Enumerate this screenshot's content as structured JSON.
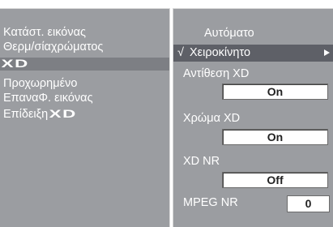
{
  "left_menu": {
    "items": [
      {
        "label": "Κατάστ. εικόνας"
      },
      {
        "label": "Θερμ/σίαχρώματος"
      },
      {
        "label": "XD"
      },
      {
        "label": "Προχωρημένο"
      },
      {
        "label": "ΕπαναΦ. εικόνας"
      },
      {
        "label": "Επίδειξη",
        "logo": "XD"
      }
    ]
  },
  "right_menu": {
    "auto_label": "Αυτόματο",
    "manual_label": "Χειροκίνητο",
    "check_mark": "√",
    "contrast_xd": {
      "label": "Αντίθεση XD",
      "value": "On"
    },
    "color_xd": {
      "label": "Χρώμα XD",
      "value": "On"
    },
    "xd_nr": {
      "label": "XD NR",
      "value": "Off"
    },
    "mpeg_nr": {
      "label": "MPEG NR",
      "value": "0"
    }
  },
  "colors": {
    "panel": "#9b9da1",
    "highlight": "#5e6067",
    "text": "#ffffff"
  },
  "icons": [
    "check-mark-icon",
    "submenu-arrow-icon",
    "xd-logo-icon"
  ]
}
